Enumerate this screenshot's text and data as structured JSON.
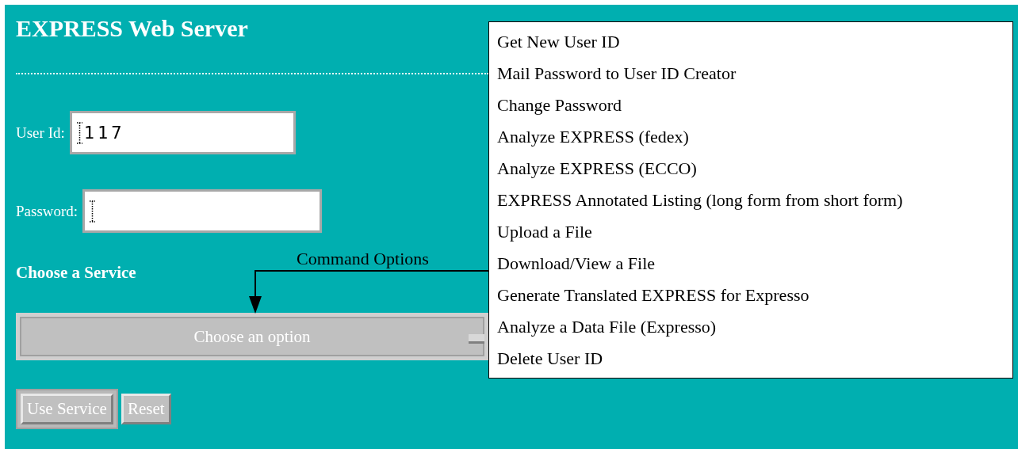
{
  "page": {
    "title": "EXPRESS Web Server"
  },
  "fields": [
    {
      "label": "User Id:",
      "value": "117"
    },
    {
      "label": "Password:"
    }
  ],
  "service": {
    "heading": "Choose a Service",
    "select": {
      "value": "Choose an option"
    }
  },
  "buttons": [
    {
      "label": "Use Service",
      "default": true
    },
    {
      "label": "Reset",
      "default": false
    }
  ],
  "annotation": {
    "label": "Command Options"
  },
  "options_list": {
    "items": [
      "Get New User ID",
      "Mail Password to User ID Creator",
      "Change Password",
      "Analyze EXPRESS (fedex)",
      "Analyze EXPRESS (ECCO)",
      "EXPRESS Annotated Listing (long form from short form)",
      "Upload a File",
      "Download/View a File",
      "Generate Translated EXPRESS for Expresso",
      "Analyze a Data File (Expresso)",
      "Delete User ID"
    ]
  }
}
